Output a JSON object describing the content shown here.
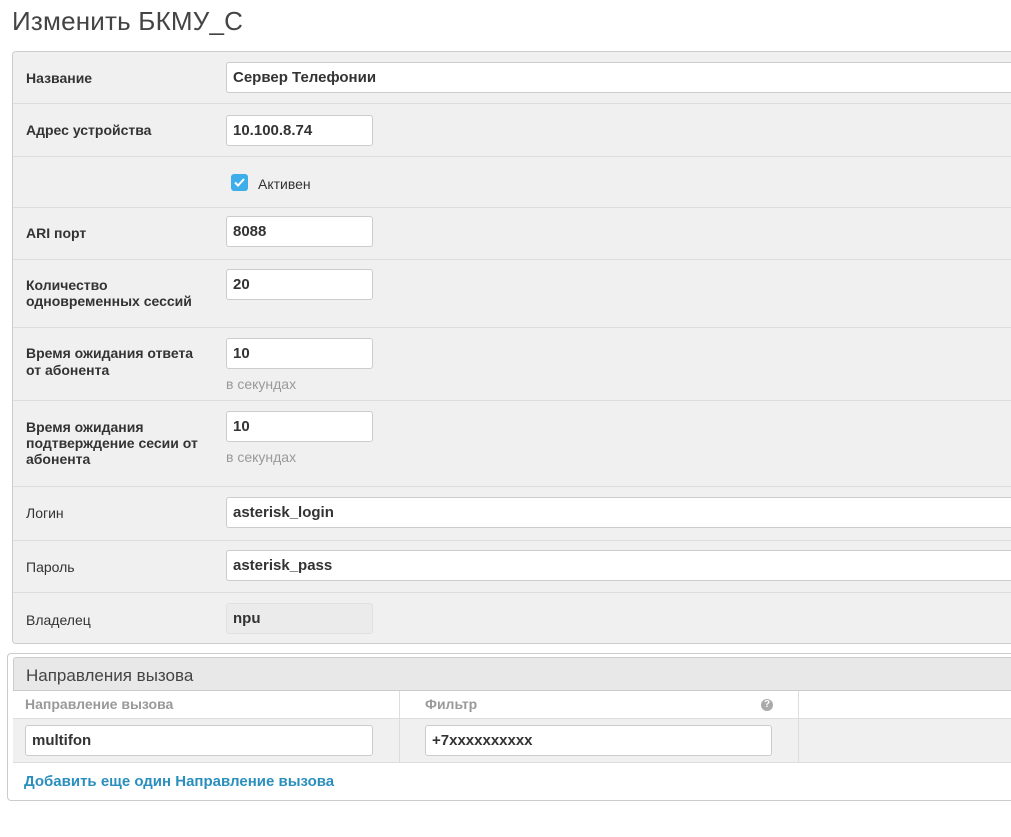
{
  "page": {
    "title": "Изменить БКМУ_С"
  },
  "form": {
    "name": {
      "label": "Название",
      "value": "Сервер Телефонии"
    },
    "address": {
      "label": "Адрес устройства",
      "value": "10.100.8.74"
    },
    "active": {
      "label": "Активен",
      "checked": true
    },
    "ari_port": {
      "label": "ARI порт",
      "value": "8088"
    },
    "sessions": {
      "label_line1": "Количество",
      "label_line2": "одновременных сессий",
      "value": "20"
    },
    "answer_timeout": {
      "label_line1": "Время ожидания ответа",
      "label_line2": "от абонента",
      "value": "10",
      "help": "в секундах"
    },
    "confirm_timeout": {
      "label_line1": "Время ожидания",
      "label_line2": "подтверждение сесии от",
      "label_line3": "абонента",
      "value": "10",
      "help": "в секундах"
    },
    "login": {
      "label": "Логин",
      "value": "asterisk_login"
    },
    "password": {
      "label": "Пароль",
      "value": "asterisk_pass"
    },
    "owner": {
      "label": "Владелец",
      "value": "npu"
    }
  },
  "inline": {
    "title": "Направления вызова",
    "headers": {
      "direction": "Направление вызова",
      "filter": "Фильтр"
    },
    "help_icon": "question-circle-icon",
    "rows": [
      {
        "direction": "multifon",
        "filter": "+7xxxxxxxxxx"
      }
    ],
    "add_link": "Добавить еще один Направление вызова"
  },
  "colors": {
    "accent": "#3daee9",
    "link": "#2a8fbd",
    "row_bg": "#f0f0f0",
    "border": "#cccccc"
  }
}
